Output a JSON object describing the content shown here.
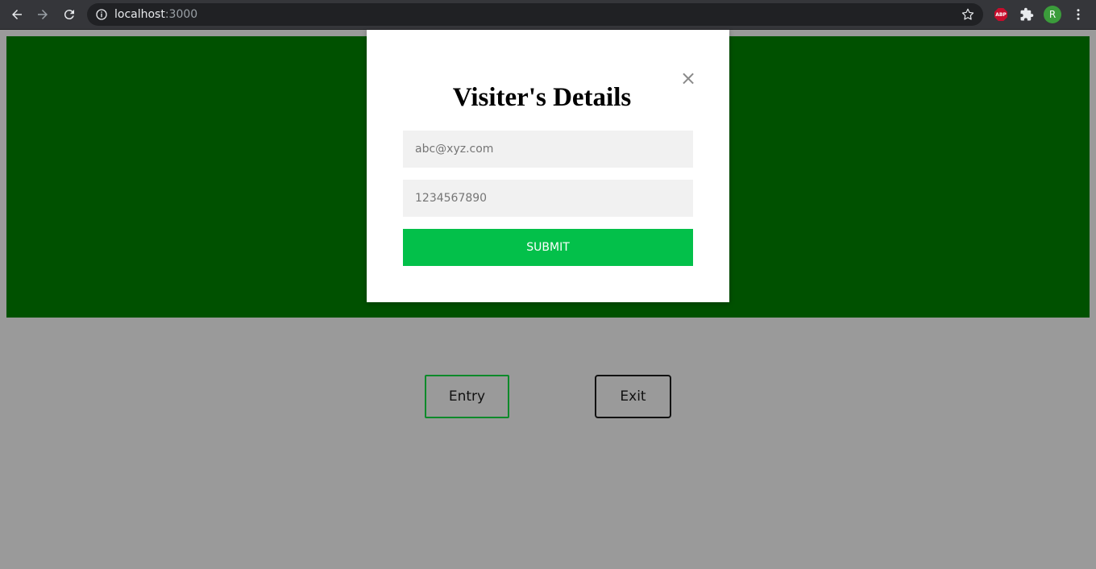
{
  "browser": {
    "url_host": "localhost",
    "url_port": ":3000",
    "profile_initial": "R",
    "extension_label": "ABP"
  },
  "page": {
    "hero_color": "#005100",
    "entry_label": "Entry",
    "exit_label": "Exit"
  },
  "modal": {
    "title": "Visiter's Details",
    "close_label": "×",
    "email_placeholder": "abc@xyz.com",
    "phone_placeholder": "1234567890",
    "submit_label": "SUBMIT",
    "submit_color": "#03c04a"
  }
}
